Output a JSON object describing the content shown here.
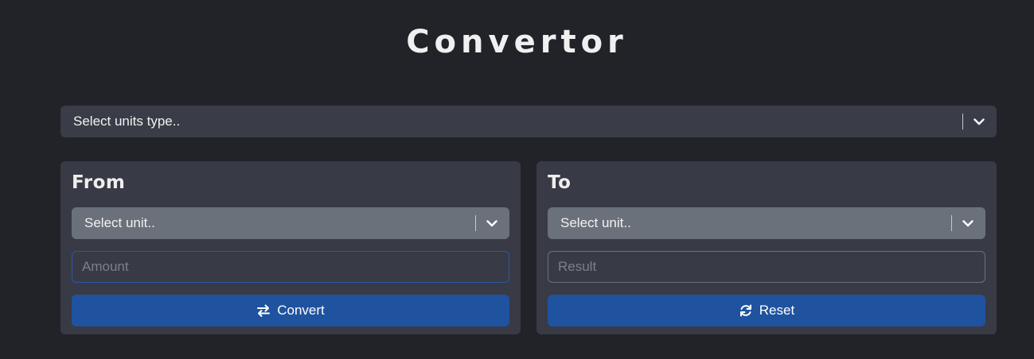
{
  "header": {
    "title": "Convertor"
  },
  "units_type_select": {
    "selected": "Select units type..",
    "icon": "chevron-down-icon"
  },
  "from_panel": {
    "heading": "From",
    "unit_select": "Select unit..",
    "amount_placeholder": "Amount",
    "amount_value": "",
    "button_label": "Convert",
    "button_icon": "swap-arrows-icon"
  },
  "to_panel": {
    "heading": "To",
    "unit_select": "Select unit..",
    "result_placeholder": "Result",
    "result_value": "",
    "button_label": "Reset",
    "button_icon": "refresh-icon"
  },
  "colors": {
    "background": "#212328",
    "panel": "#383b45",
    "accent": "#1f53a0",
    "unit_select": "#6b717a"
  }
}
